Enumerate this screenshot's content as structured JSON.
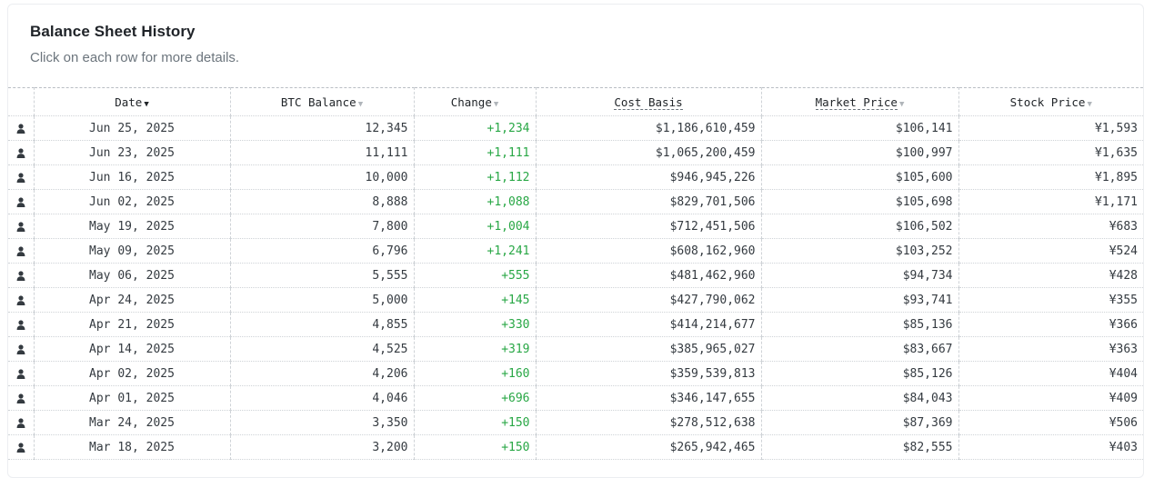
{
  "card": {
    "title": "Balance Sheet History",
    "subtitle": "Click on each row for more details."
  },
  "table": {
    "columns": [
      {
        "label": "Date",
        "sort_icon": "chevron-down-icon"
      },
      {
        "label": "BTC Balance",
        "sort_icon": "chevron-down-icon"
      },
      {
        "label": "Change",
        "sort_icon": "chevron-down-icon"
      },
      {
        "label": "Cost Basis",
        "sort_icon": ""
      },
      {
        "label": "Market Price",
        "sort_icon": "chevron-down-icon"
      },
      {
        "label": "Stock Price",
        "sort_icon": "chevron-down-icon"
      }
    ],
    "row_icon": "person-icon",
    "change_color": "#28a745",
    "rows": [
      {
        "date": "Jun 25, 2025",
        "btc": "12,345",
        "change": "+1,234",
        "cost": "$1,186,610,459",
        "market": "$106,141",
        "stock": "¥1,593"
      },
      {
        "date": "Jun 23, 2025",
        "btc": "11,111",
        "change": "+1,111",
        "cost": "$1,065,200,459",
        "market": "$100,997",
        "stock": "¥1,635"
      },
      {
        "date": "Jun 16, 2025",
        "btc": "10,000",
        "change": "+1,112",
        "cost": "$946,945,226",
        "market": "$105,600",
        "stock": "¥1,895"
      },
      {
        "date": "Jun 02, 2025",
        "btc": "8,888",
        "change": "+1,088",
        "cost": "$829,701,506",
        "market": "$105,698",
        "stock": "¥1,171"
      },
      {
        "date": "May 19, 2025",
        "btc": "7,800",
        "change": "+1,004",
        "cost": "$712,451,506",
        "market": "$106,502",
        "stock": "¥683"
      },
      {
        "date": "May 09, 2025",
        "btc": "6,796",
        "change": "+1,241",
        "cost": "$608,162,960",
        "market": "$103,252",
        "stock": "¥524"
      },
      {
        "date": "May 06, 2025",
        "btc": "5,555",
        "change": "+555",
        "cost": "$481,462,960",
        "market": "$94,734",
        "stock": "¥428"
      },
      {
        "date": "Apr 24, 2025",
        "btc": "5,000",
        "change": "+145",
        "cost": "$427,790,062",
        "market": "$93,741",
        "stock": "¥355"
      },
      {
        "date": "Apr 21, 2025",
        "btc": "4,855",
        "change": "+330",
        "cost": "$414,214,677",
        "market": "$85,136",
        "stock": "¥366"
      },
      {
        "date": "Apr 14, 2025",
        "btc": "4,525",
        "change": "+319",
        "cost": "$385,965,027",
        "market": "$83,667",
        "stock": "¥363"
      },
      {
        "date": "Apr 02, 2025",
        "btc": "4,206",
        "change": "+160",
        "cost": "$359,539,813",
        "market": "$85,126",
        "stock": "¥404"
      },
      {
        "date": "Apr 01, 2025",
        "btc": "4,046",
        "change": "+696",
        "cost": "$346,147,655",
        "market": "$84,043",
        "stock": "¥409"
      },
      {
        "date": "Mar 24, 2025",
        "btc": "3,350",
        "change": "+150",
        "cost": "$278,512,638",
        "market": "$87,369",
        "stock": "¥506"
      },
      {
        "date": "Mar 18, 2025",
        "btc": "3,200",
        "change": "+150",
        "cost": "$265,942,465",
        "market": "$82,555",
        "stock": "¥403"
      }
    ]
  }
}
